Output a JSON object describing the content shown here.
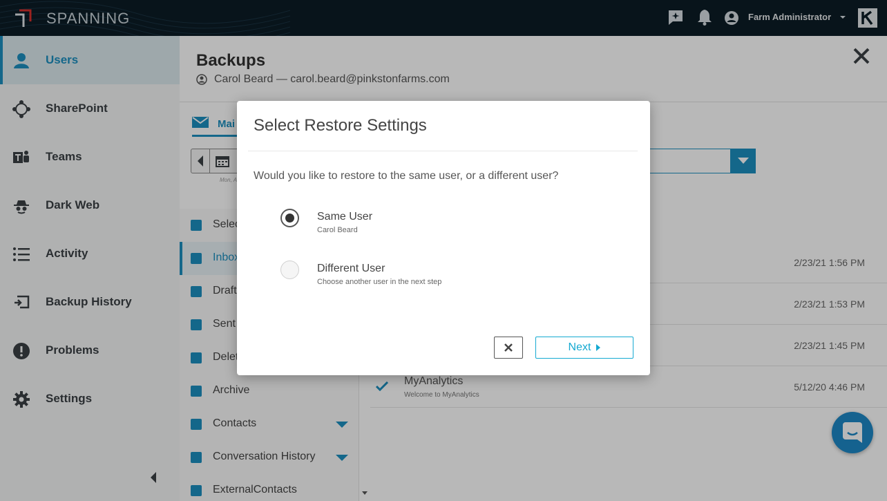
{
  "app": {
    "name": "SPANNING",
    "logo_icon": "spanning-logo-icon"
  },
  "topbar": {
    "admin_name": "Farm Administrator",
    "icons": [
      "feedback-icon",
      "bell-icon",
      "account-icon",
      "chevron-down-icon",
      "kaseya-logo-icon"
    ]
  },
  "sidebar": {
    "items": [
      {
        "label": "Users",
        "icon": "user-icon",
        "active": true
      },
      {
        "label": "SharePoint",
        "icon": "sharepoint-icon"
      },
      {
        "label": "Teams",
        "icon": "teams-icon"
      },
      {
        "label": "Dark Web",
        "icon": "dark-web-icon"
      },
      {
        "label": "Activity",
        "icon": "list-icon"
      },
      {
        "label": "Backup History",
        "icon": "backup-history-icon"
      },
      {
        "label": "Problems",
        "icon": "alert-icon"
      },
      {
        "label": "Settings",
        "icon": "gear-icon"
      }
    ]
  },
  "main": {
    "title": "Backups",
    "user_line": "Carol Beard — carol.beard@pinkstonfarms.com",
    "tab_label": "Mai",
    "date_sub": "Mon, A",
    "folders": [
      {
        "label": "Selec"
      },
      {
        "label": "Inbox",
        "active": true
      },
      {
        "label": "Draft"
      },
      {
        "label": "Sent"
      },
      {
        "label": "Delet"
      },
      {
        "label": "Archive"
      },
      {
        "label": "Contacts",
        "has_caret": true
      },
      {
        "label": "Conversation History",
        "has_caret": true
      },
      {
        "label": "ExternalContacts"
      }
    ],
    "emails": [
      {
        "date": "2/23/21 1:56 PM"
      },
      {
        "date": "2/23/21 1:53 PM"
      },
      {
        "date": "2/23/21 1:45 PM"
      },
      {
        "subject": "MyAnalytics",
        "preview": "Welcome to MyAnalytics",
        "date": "5/12/20 4:46 PM"
      }
    ]
  },
  "modal": {
    "title": "Select Restore Settings",
    "question": "Would you like to restore to the same user, or a different user?",
    "options": [
      {
        "label": "Same User",
        "sub": "Carol Beard",
        "selected": true
      },
      {
        "label": "Different User",
        "sub": "Choose another user in the next step",
        "selected": false
      }
    ],
    "next_label": "Next"
  },
  "colors": {
    "accent": "#1c8fbf",
    "topbar": "#0c1c26",
    "next": "#14a9d1",
    "chat": "#1e88c7"
  }
}
